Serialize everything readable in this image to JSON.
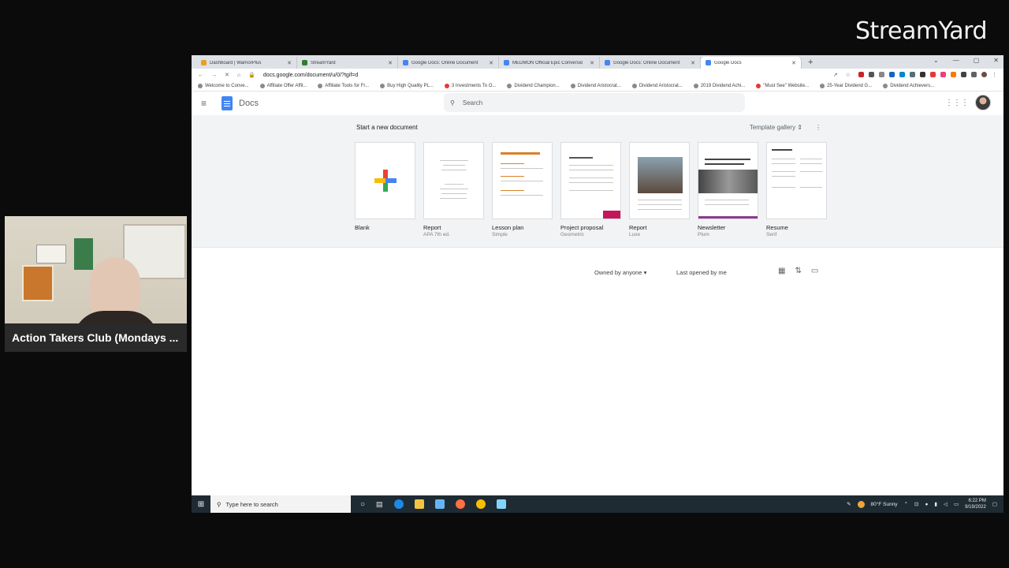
{
  "overlay": {
    "brand": "StreamYard",
    "speaker_label": "Action Takers Club (Mondays ..."
  },
  "browser": {
    "tabs": [
      {
        "title": "Dashboard | WarriorPlus",
        "color": "#e8a020"
      },
      {
        "title": "StreamYard",
        "color": "#2e7d32"
      },
      {
        "title": "Google Docs: Online Document",
        "color": "#4285f4"
      },
      {
        "title": "MEDMON Official Epic Conversio",
        "color": "#4285f4"
      },
      {
        "title": "Google Docs: Online Document",
        "color": "#4285f4"
      },
      {
        "title": "Google Docs",
        "color": "#4285f4"
      }
    ],
    "new_tab": "+",
    "url": "docs.google.com/document/u/0/?tgif=d",
    "bookmarks": [
      "Welcome to Conve...",
      "Affiliate Offer Affil...",
      "Affiliate Tools for Fr...",
      "Buy High Quality PL...",
      "3 Investments To O...",
      "Dividend Champion...",
      "Dividend Aristocrat...",
      "Dividend Aristocrat...",
      "2019 Dividend Achi...",
      "\"Must See\" Website...",
      "25-Year Dividend G...",
      "Dividend Achievers..."
    ]
  },
  "docs": {
    "app_name": "Docs",
    "search_placeholder": "Search",
    "gallery_heading": "Start a new document",
    "template_gallery": "Template gallery",
    "templates": [
      {
        "name": "Blank",
        "sub": ""
      },
      {
        "name": "Report",
        "sub": "APA 7th ed."
      },
      {
        "name": "Lesson plan",
        "sub": "Simple"
      },
      {
        "name": "Project proposal",
        "sub": "Geometric"
      },
      {
        "name": "Report",
        "sub": "Luxe"
      },
      {
        "name": "Newsletter",
        "sub": "Plum"
      },
      {
        "name": "Resume",
        "sub": "Serif"
      }
    ],
    "owned_by": "Owned by anyone",
    "sort": "Last opened by me"
  },
  "taskbar": {
    "search_placeholder": "Type here to search",
    "weather": "80°F  Sunny",
    "time": "6:22 PM",
    "date": "9/19/2022"
  }
}
